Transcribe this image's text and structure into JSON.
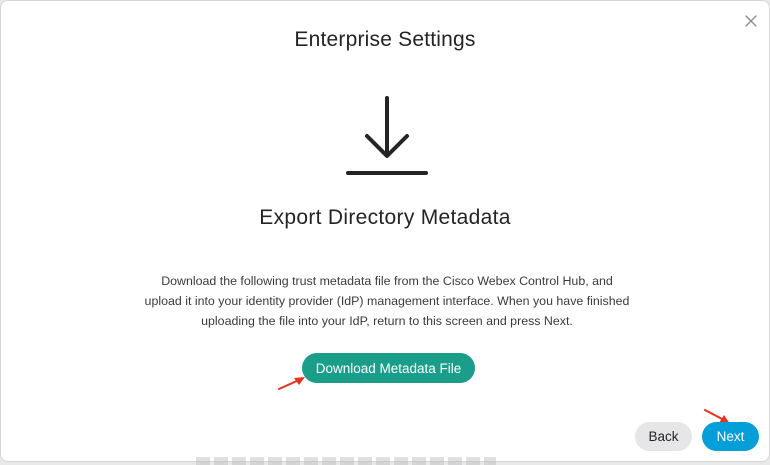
{
  "modal": {
    "title": "Enterprise Settings",
    "close_icon": "close-icon",
    "hero_icon": "download-icon",
    "subtitle": "Export Directory Metadata",
    "description": "Download the following trust metadata file from the Cisco Webex Control Hub, and upload it into your identity provider (IdP) management interface. When you have finished uploading the file into your IdP, return to this screen and press Next.",
    "download_button_label": "Download Metadata File",
    "back_button_label": "Back",
    "next_button_label": "Next"
  },
  "annotations": {
    "arrow_icon": "red-pointer-arrow-icon",
    "arrow_color": "#e8321e"
  },
  "colors": {
    "primary_teal": "#1a9e8a",
    "next_blue": "#049fd9",
    "back_gray": "#e6e6e8"
  }
}
